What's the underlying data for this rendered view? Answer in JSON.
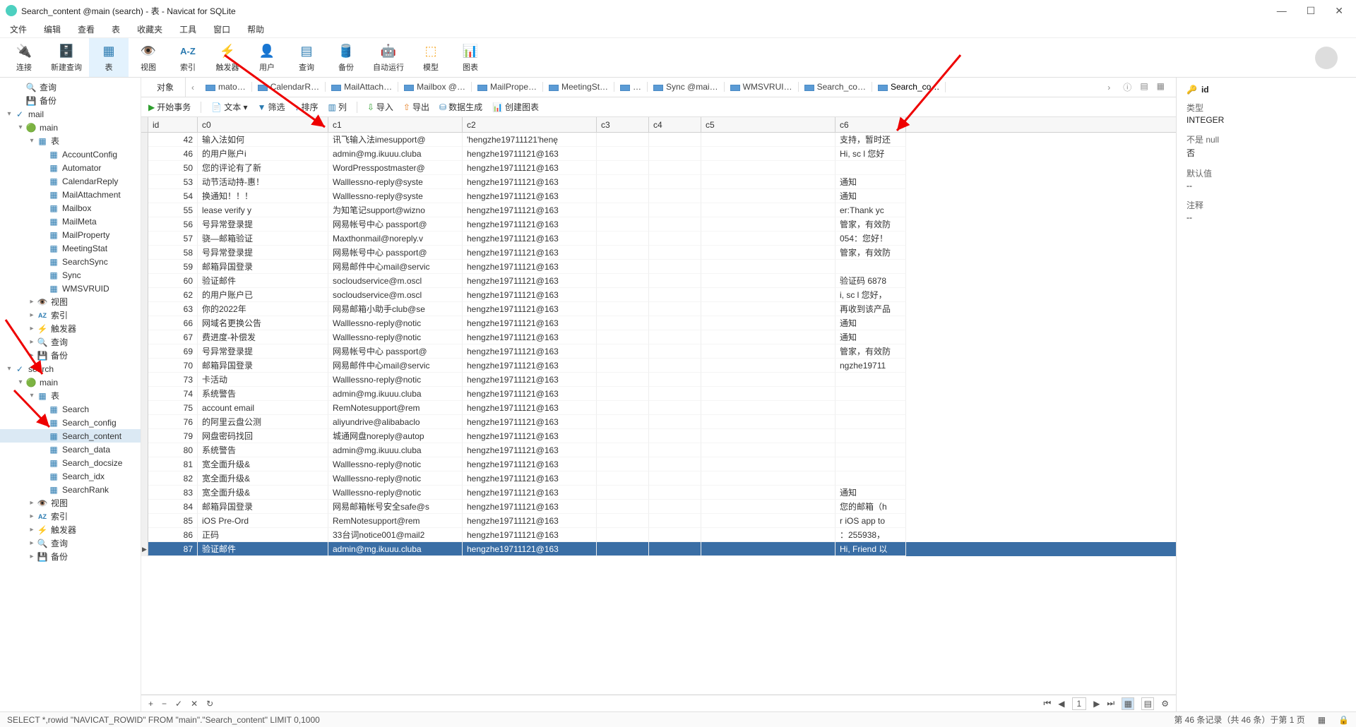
{
  "titlebar": {
    "title": "Search_content @main (search) - 表 - Navicat for SQLite"
  },
  "menu": [
    "文件",
    "编辑",
    "查看",
    "表",
    "收藏夹",
    "工具",
    "窗口",
    "帮助"
  ],
  "toolbar": [
    {
      "icon": "🔌",
      "label": "连接",
      "color": "#2e9e2e"
    },
    {
      "icon": "🗄️",
      "label": "新建查询",
      "color": "#2a7ab0"
    },
    {
      "icon": "▦",
      "label": "表",
      "color": "#2a7ab0",
      "active": true
    },
    {
      "icon": "👁️",
      "label": "视图",
      "color": "#2a7ab0"
    },
    {
      "icon": "A-Z",
      "label": "索引",
      "color": "#2a7ab0",
      "text": true
    },
    {
      "icon": "⚡",
      "label": "触发器",
      "color": "#f5a623"
    },
    {
      "icon": "👤",
      "label": "用户",
      "color": "#f5a623"
    },
    {
      "icon": "▤",
      "label": "查询",
      "color": "#2a7ab0"
    },
    {
      "icon": "🛢️",
      "label": "备份",
      "color": "#2a7ab0"
    },
    {
      "icon": "🤖",
      "label": "自动运行",
      "color": "#2aa198"
    },
    {
      "icon": "⬚",
      "label": "模型",
      "color": "#f5a623"
    },
    {
      "icon": "📊",
      "label": "图表",
      "color": "#8e44ad"
    }
  ],
  "sidebar": [
    {
      "d": 1,
      "tw": "",
      "icon": "🔍",
      "label": "查询",
      "color": "#e67e22"
    },
    {
      "d": 1,
      "tw": "",
      "icon": "💾",
      "label": "备份",
      "color": "#3a8fd4"
    },
    {
      "d": 0,
      "tw": "▾",
      "icon": "✓",
      "label": "mail",
      "color": "#2a7ab0"
    },
    {
      "d": 1,
      "tw": "▾",
      "icon": "🟢",
      "label": "main",
      "color": "#2e9e2e"
    },
    {
      "d": 2,
      "tw": "▾",
      "icon": "▦",
      "label": "表",
      "color": "#2a7ab0"
    },
    {
      "d": 3,
      "tw": "",
      "icon": "▦",
      "label": "AccountConfig",
      "color": "#2a7ab0"
    },
    {
      "d": 3,
      "tw": "",
      "icon": "▦",
      "label": "Automator",
      "color": "#2a7ab0"
    },
    {
      "d": 3,
      "tw": "",
      "icon": "▦",
      "label": "CalendarReply",
      "color": "#2a7ab0"
    },
    {
      "d": 3,
      "tw": "",
      "icon": "▦",
      "label": "MailAttachment",
      "color": "#2a7ab0"
    },
    {
      "d": 3,
      "tw": "",
      "icon": "▦",
      "label": "Mailbox",
      "color": "#2a7ab0"
    },
    {
      "d": 3,
      "tw": "",
      "icon": "▦",
      "label": "MailMeta",
      "color": "#2a7ab0"
    },
    {
      "d": 3,
      "tw": "",
      "icon": "▦",
      "label": "MailProperty",
      "color": "#2a7ab0"
    },
    {
      "d": 3,
      "tw": "",
      "icon": "▦",
      "label": "MeetingStat",
      "color": "#2a7ab0"
    },
    {
      "d": 3,
      "tw": "",
      "icon": "▦",
      "label": "SearchSync",
      "color": "#2a7ab0"
    },
    {
      "d": 3,
      "tw": "",
      "icon": "▦",
      "label": "Sync",
      "color": "#2a7ab0"
    },
    {
      "d": 3,
      "tw": "",
      "icon": "▦",
      "label": "WMSVRUID",
      "color": "#2a7ab0"
    },
    {
      "d": 2,
      "tw": "▸",
      "icon": "👁️",
      "label": "视图",
      "color": "#2a7ab0"
    },
    {
      "d": 2,
      "tw": "▸",
      "icon": "AZ",
      "label": "索引",
      "color": "#2a7ab0",
      "text": true
    },
    {
      "d": 2,
      "tw": "▸",
      "icon": "⚡",
      "label": "触发器",
      "color": "#f5a623"
    },
    {
      "d": 2,
      "tw": "▸",
      "icon": "🔍",
      "label": "查询",
      "color": "#e67e22"
    },
    {
      "d": 2,
      "tw": "▸",
      "icon": "💾",
      "label": "备份",
      "color": "#3a8fd4"
    },
    {
      "d": 0,
      "tw": "▾",
      "icon": "✓",
      "label": "search",
      "color": "#2a7ab0"
    },
    {
      "d": 1,
      "tw": "▾",
      "icon": "🟢",
      "label": "main",
      "color": "#2e9e2e"
    },
    {
      "d": 2,
      "tw": "▾",
      "icon": "▦",
      "label": "表",
      "color": "#2a7ab0"
    },
    {
      "d": 3,
      "tw": "",
      "icon": "▦",
      "label": "Search",
      "color": "#2a7ab0"
    },
    {
      "d": 3,
      "tw": "",
      "icon": "▦",
      "label": "Search_config",
      "color": "#2a7ab0"
    },
    {
      "d": 3,
      "tw": "",
      "icon": "▦",
      "label": "Search_content",
      "color": "#2a7ab0",
      "sel": true
    },
    {
      "d": 3,
      "tw": "",
      "icon": "▦",
      "label": "Search_data",
      "color": "#2a7ab0"
    },
    {
      "d": 3,
      "tw": "",
      "icon": "▦",
      "label": "Search_docsize",
      "color": "#2a7ab0"
    },
    {
      "d": 3,
      "tw": "",
      "icon": "▦",
      "label": "Search_idx",
      "color": "#2a7ab0"
    },
    {
      "d": 3,
      "tw": "",
      "icon": "▦",
      "label": "SearchRank",
      "color": "#2a7ab0"
    },
    {
      "d": 2,
      "tw": "▸",
      "icon": "👁️",
      "label": "视图",
      "color": "#2a7ab0"
    },
    {
      "d": 2,
      "tw": "▸",
      "icon": "AZ",
      "label": "索引",
      "color": "#2a7ab0",
      "text": true
    },
    {
      "d": 2,
      "tw": "▸",
      "icon": "⚡",
      "label": "触发器",
      "color": "#f5a623"
    },
    {
      "d": 2,
      "tw": "▸",
      "icon": "🔍",
      "label": "查询",
      "color": "#e67e22"
    },
    {
      "d": 2,
      "tw": "▸",
      "icon": "💾",
      "label": "备份",
      "color": "#3a8fd4"
    }
  ],
  "tabs": {
    "first": "对象",
    "items": [
      "mato…",
      "CalendarR…",
      "MailAttach…",
      "Mailbox @…",
      "MailPrope…",
      "MeetingSt…",
      "…",
      "Sync @mai…",
      "WMSVRUI…",
      "Search_co…",
      "Search_co…"
    ],
    "active": 10
  },
  "actions": [
    {
      "i": "▶",
      "cls": "i",
      "label": "开始事务"
    },
    {
      "i": "📄",
      "cls": "ib",
      "label": "文本 ▾"
    },
    {
      "i": "▼",
      "cls": "ib",
      "label": "筛选"
    },
    {
      "i": "↕",
      "cls": "ib",
      "label": "排序"
    },
    {
      "i": "▥",
      "cls": "ib",
      "label": "列"
    },
    {
      "i": "⇩",
      "cls": "i",
      "label": "导入"
    },
    {
      "i": "⇧",
      "cls": "io",
      "label": "导出"
    },
    {
      "i": "⛁",
      "cls": "ib",
      "label": "数据生成"
    },
    {
      "i": "📊",
      "cls": "ib",
      "label": "创建图表"
    }
  ],
  "columns": [
    "id",
    "c0",
    "c1",
    "c2",
    "c3",
    "c4",
    "c5",
    "c6"
  ],
  "rows": [
    {
      "id": 42,
      "c0": "输入法如何",
      "c1": "讯飞输入法imesupport@",
      "c2": "'hengzhe19711121'henę",
      "c5": "",
      "c6": "支持，暂时还"
    },
    {
      "id": 46,
      "c0": "的用户账户i",
      "c1": "admin@mg.ikuuu.cluba",
      "c2": "hengzhe19711121@163",
      "c5": "",
      "c6": "Hi, sc l 您好"
    },
    {
      "id": 50,
      "c0": "您的评论有了新",
      "c1": "WordPresspostmaster@",
      "c2": "hengzhe19711121@163",
      "c5": "",
      "c6": ""
    },
    {
      "id": 53,
      "c0": "动节活动持-惠！",
      "c1": "Walllessno-reply@syste",
      "c2": "hengzhe19711121@163",
      "c5": "",
      "c6": "通知"
    },
    {
      "id": 54,
      "c0": "换通知！！！",
      "c1": "Walllessno-reply@syste",
      "c2": "hengzhe19711121@163",
      "c5": "",
      "c6": "通知"
    },
    {
      "id": 55,
      "c0": "lease verify y",
      "c1": "为知笔记support@wizno",
      "c2": "hengzhe19711121@163",
      "c5": "",
      "c6": "er:Thank yc"
    },
    {
      "id": 56,
      "c0": "号异常登录提",
      "c1": "网易帐号中心 passport@",
      "c2": "hengzhe19711121@163",
      "c5": "",
      "c6": "管家，有效防"
    },
    {
      "id": 57,
      "c0": "骁—邮箱验证",
      "c1": "Maxthonmail@noreply.v",
      "c2": "hengzhe19711121@163",
      "c5": "",
      "c6": "054：您好！"
    },
    {
      "id": 58,
      "c0": "号异常登录提",
      "c1": "网易帐号中心 passport@",
      "c2": "hengzhe19711121@163",
      "c5": "",
      "c6": "管家，有效防"
    },
    {
      "id": 59,
      "c0": "邮箱异国登录",
      "c1": "网易邮件中心mail@servic",
      "c2": "hengzhe19711121@163",
      "c5": "",
      "c6": ""
    },
    {
      "id": 60,
      "c0": "验证邮件",
      "c1": "socloudservice@m.oscl",
      "c2": "hengzhe19711121@163",
      "c5": "",
      "c6": "验证码 6878"
    },
    {
      "id": 62,
      "c0": "的用户账户已",
      "c1": "socloudservice@m.oscl",
      "c2": "hengzhe19711121@163",
      "c5": "",
      "c6": "i, sc l 您好，"
    },
    {
      "id": 63,
      "c0": "你的2022年",
      "c1": "网易邮箱小助手club@se",
      "c2": "hengzhe19711121@163",
      "c5": "",
      "c6": "再收到该产品"
    },
    {
      "id": 66,
      "c0": "网域名更换公告",
      "c1": "Walllessno-reply@notic",
      "c2": "hengzhe19711121@163",
      "c5": "",
      "c6": "通知"
    },
    {
      "id": 67,
      "c0": "费进度-补偿发",
      "c1": "Walllessno-reply@notic",
      "c2": "hengzhe19711121@163",
      "c5": "",
      "c6": "通知"
    },
    {
      "id": 69,
      "c0": "号异常登录提",
      "c1": "网易帐号中心 passport@",
      "c2": "hengzhe19711121@163",
      "c5": "",
      "c6": "管家，有效防"
    },
    {
      "id": 70,
      "c0": "邮箱异国登录",
      "c1": "网易邮件中心mail@servic",
      "c2": "hengzhe19711121@163",
      "c5": "",
      "c6": "ngzhe19711"
    },
    {
      "id": 73,
      "c0": "卡活动",
      "c1": "Walllessno-reply@notic",
      "c2": "hengzhe19711121@163",
      "c5": "",
      "c6": ""
    },
    {
      "id": 74,
      "c0": "系统警告",
      "c1": "admin@mg.ikuuu.cluba",
      "c2": "hengzhe19711121@163",
      "c5": "",
      "c6": ""
    },
    {
      "id": 75,
      "c0": "account email",
      "c1": "RemNotesupport@rem",
      "c2": "hengzhe19711121@163",
      "c5": "",
      "c6": ""
    },
    {
      "id": 76,
      "c0": "的阿里云盘公测",
      "c1": "aliyundrive@alibabaclo",
      "c2": "hengzhe19711121@163",
      "c5": "",
      "c6": ""
    },
    {
      "id": 79,
      "c0": "网盘密码找回",
      "c1": "城通网盘noreply@autop",
      "c2": "hengzhe19711121@163",
      "c5": "",
      "c6": ""
    },
    {
      "id": 80,
      "c0": "系统警告",
      "c1": "admin@mg.ikuuu.cluba",
      "c2": "hengzhe19711121@163",
      "c5": "",
      "c6": ""
    },
    {
      "id": 81,
      "c0": "宽全面升级&",
      "c1": "Walllessno-reply@notic",
      "c2": "hengzhe19711121@163",
      "c5": "",
      "c6": ""
    },
    {
      "id": 82,
      "c0": "宽全面升级&",
      "c1": "Walllessno-reply@notic",
      "c2": "hengzhe19711121@163",
      "c5": "",
      "c6": ""
    },
    {
      "id": 83,
      "c0": "宽全面升级&",
      "c1": "Walllessno-reply@notic",
      "c2": "hengzhe19711121@163",
      "c5": "",
      "c6": "通知"
    },
    {
      "id": 84,
      "c0": "邮箱异国登录",
      "c1": "网易邮箱帐号安全safe@s",
      "c2": "hengzhe19711121@163",
      "c5": "",
      "c6": "您的邮箱（h"
    },
    {
      "id": 85,
      "c0": "iOS Pre-Ord",
      "c1": "RemNotesupport@rem",
      "c2": "hengzhe19711121@163",
      "c5": "",
      "c6": "r iOS app to"
    },
    {
      "id": 86,
      "c0": "正码",
      "c1": "33台词notice001@mail2",
      "c2": "hengzhe19711121@163",
      "c5": "",
      "c6": "：255938，"
    },
    {
      "id": 87,
      "c0": "验证邮件",
      "c1": "admin@mg.ikuuu.cluba",
      "c2": "hengzhe19711121@163",
      "c5": "",
      "c6": "Hi, Friend 以",
      "sel": true,
      "cur": true
    }
  ],
  "gridfoot": {
    "plus": "+",
    "minus": "−",
    "check": "✓",
    "x": "✕",
    "refresh": "↻",
    "page": "1"
  },
  "status": {
    "sql": "SELECT *,rowid \"NAVICAT_ROWID\" FROM \"main\".\"Search_content\" LIMIT 0,1000",
    "count": "第 46 条记录（共 46 条）于第 1 页"
  },
  "props": {
    "title": "id",
    "type_label": "类型",
    "type": "INTEGER",
    "nn_label": "不是 null",
    "nn": "否",
    "def_label": "默认值",
    "def": "--",
    "ann_label": "注释",
    "ann": "--"
  }
}
